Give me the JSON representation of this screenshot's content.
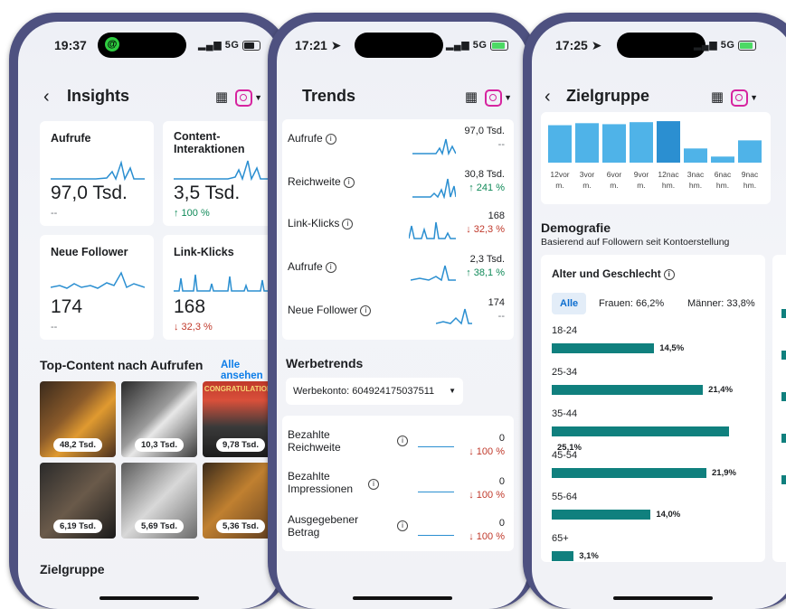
{
  "phone1": {
    "time": "19:37",
    "signal": "5G",
    "title": "Insights",
    "cards": [
      {
        "label": "Aufrufe",
        "value": "97,0 Tsd.",
        "change": "--",
        "change_type": "neutral"
      },
      {
        "label": "Content-Interaktionen",
        "value": "3,5 Tsd.",
        "change": "↑ 100 %",
        "change_type": "up"
      },
      {
        "label": "Neue Follower",
        "value": "174",
        "change": "--",
        "change_type": "neutral"
      },
      {
        "label": "Link-Klicks",
        "value": "168",
        "change": "↓ 32,3 %",
        "change_type": "down"
      }
    ],
    "top_content_title": "Top-Content nach Aufrufen",
    "see_all": "Alle ansehen",
    "thumbnails": [
      "48,2 Tsd.",
      "10,3 Tsd.",
      "9,78 Tsd.",
      "6,19 Tsd.",
      "5,69 Tsd.",
      "5,36 Tsd."
    ],
    "thumb_caption": "CONGRATULATIONS",
    "audience_title": "Zielgruppe"
  },
  "phone2": {
    "time": "17:21",
    "signal": "5G",
    "title": "Trends",
    "trends": [
      {
        "label": "Aufrufe",
        "value": "97,0 Tsd.",
        "change": "--",
        "change_type": "neutral"
      },
      {
        "label": "Reichweite",
        "value": "30,8 Tsd.",
        "change": "↑ 241 %",
        "change_type": "up"
      },
      {
        "label": "Link-Klicks",
        "value": "168",
        "change": "↓ 32,3 %",
        "change_type": "down"
      },
      {
        "label": "Aufrufe",
        "value": "2,3 Tsd.",
        "change": "↑ 38,1 %",
        "change_type": "up"
      },
      {
        "label": "Neue Follower",
        "value": "174",
        "change": "--",
        "change_type": "neutral"
      }
    ],
    "ad_title": "Werbetrends",
    "ad_account": "Werbekonto: 604924175037511",
    "ad_rows": [
      {
        "label": "Bezahlte Reichweite",
        "value": "0",
        "change": "↓ 100 %"
      },
      {
        "label": "Bezahlte Impressionen",
        "value": "0",
        "change": "↓ 100 %"
      },
      {
        "label": "Ausgegebener Betrag",
        "value": "0",
        "change": "↓ 100 %"
      }
    ]
  },
  "phone3": {
    "time": "17:25",
    "signal": "5G",
    "title": "Zielgruppe",
    "hour_bars": [
      {
        "label": "12vor m.",
        "value": 0.74
      },
      {
        "label": "3vor m.",
        "value": 0.78
      },
      {
        "label": "6vor m.",
        "value": 0.76
      },
      {
        "label": "9vor m.",
        "value": 0.8
      },
      {
        "label": "12nac hm.",
        "value": 0.82,
        "highlight": true
      },
      {
        "label": "3nac hm.",
        "value": 0.28
      },
      {
        "label": "6nac hm.",
        "value": 0.12
      },
      {
        "label": "9nac hm.",
        "value": 0.44
      }
    ],
    "demo_title": "Demografie",
    "demo_sub": "Basierend auf Followern seit Kontoerstellung",
    "age_title": "Alter und Geschlecht",
    "tab_all": "Alle",
    "women": "Frauen: 66,2%",
    "men": "Männer: 33,8%",
    "ages": [
      {
        "label": "18-24",
        "pct": "14,5%",
        "value": 14.5
      },
      {
        "label": "25-34",
        "pct": "21,4%",
        "value": 21.4
      },
      {
        "label": "35-44",
        "pct": "25,1%",
        "value": 25.1
      },
      {
        "label": "45-54",
        "pct": "21,9%",
        "value": 21.9
      },
      {
        "label": "55-64",
        "pct": "14,0%",
        "value": 14.0
      },
      {
        "label": "65+",
        "pct": "3,1%",
        "value": 3.1
      }
    ]
  },
  "colors": {
    "accent": "#0d7de8",
    "bar": "#4fb3e8",
    "bar_highlight": "#2b8fd1",
    "age_bar": "#10807e",
    "up": "#108a59",
    "down": "#c0392b"
  }
}
